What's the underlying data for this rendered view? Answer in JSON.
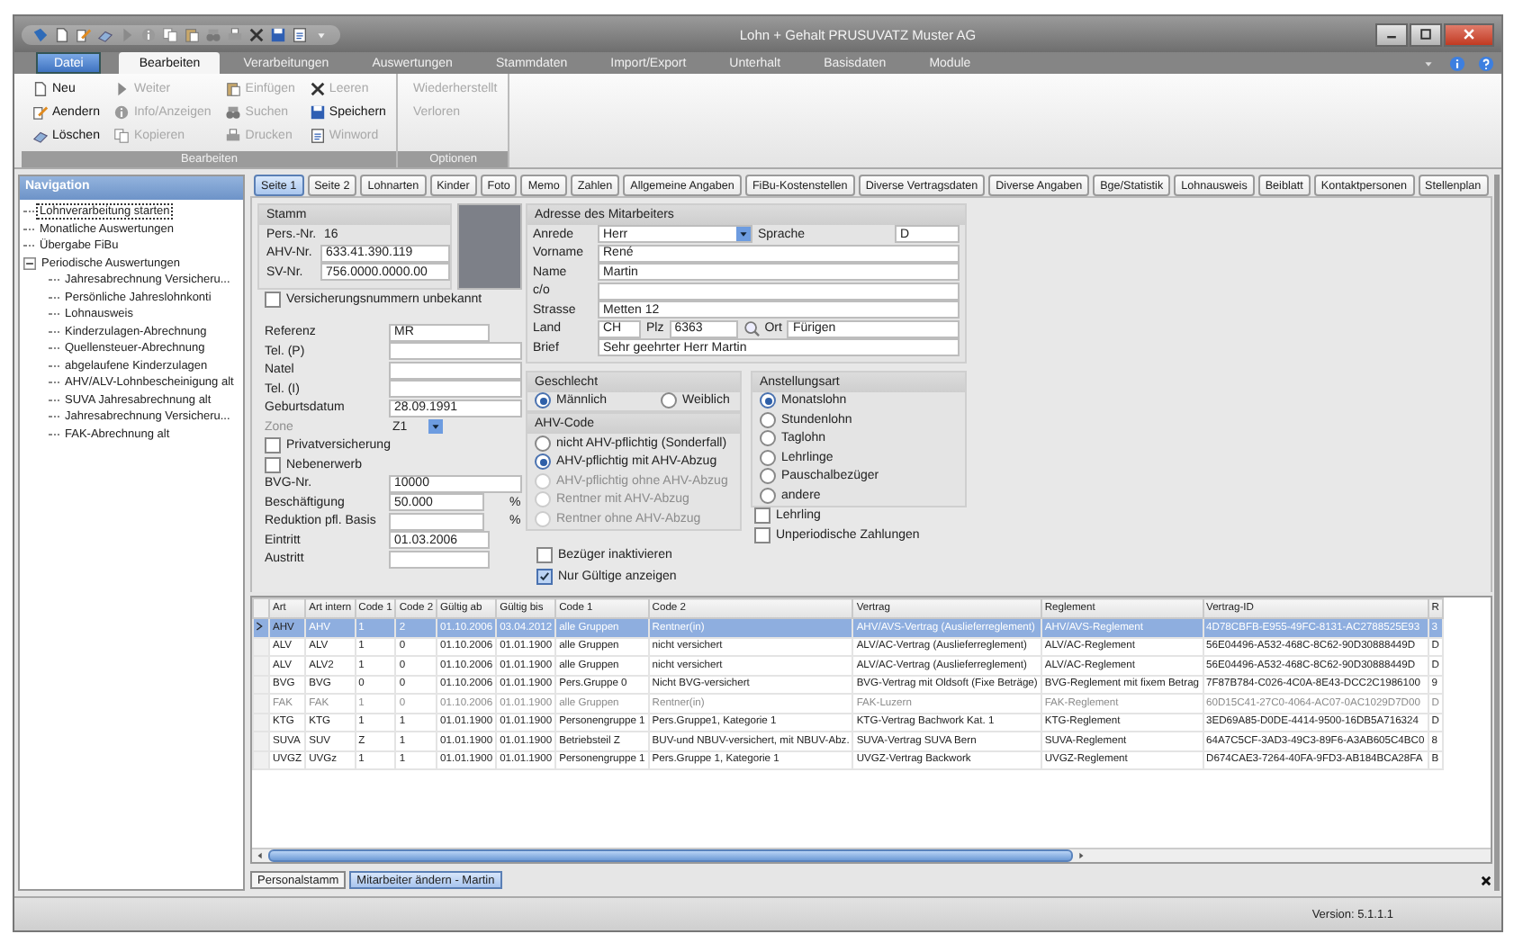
{
  "window": {
    "title": "Lohn + Gehalt PRUSUVATZ Muster AG"
  },
  "ribbon": {
    "file_button": "Datei",
    "tabs": [
      {
        "label": "Bearbeiten",
        "selected": true
      },
      {
        "label": "Verarbeitungen",
        "selected": false
      },
      {
        "label": "Auswertungen",
        "selected": false
      },
      {
        "label": "Stammdaten",
        "selected": false
      },
      {
        "label": "Import/Export",
        "selected": false
      },
      {
        "label": "Unterhalt",
        "selected": false
      },
      {
        "label": "Basisdaten",
        "selected": false
      },
      {
        "label": "Module",
        "selected": false
      }
    ],
    "groups": [
      {
        "label": "Bearbeiten",
        "items": [
          {
            "label": "Neu",
            "disabled": false
          },
          {
            "label": "Aendern",
            "disabled": false
          },
          {
            "label": "Löschen",
            "disabled": false
          },
          {
            "label": "Weiter",
            "disabled": true
          },
          {
            "label": "Info/Anzeigen",
            "disabled": true
          },
          {
            "label": "Kopieren",
            "disabled": true
          },
          {
            "label": "Einfügen",
            "disabled": true
          },
          {
            "label": "Suchen",
            "disabled": true
          },
          {
            "label": "Drucken",
            "disabled": true
          },
          {
            "label": "Leeren",
            "disabled": true
          },
          {
            "label": "Speichern",
            "disabled": false
          },
          {
            "label": "Winword",
            "disabled": true
          }
        ]
      },
      {
        "label": "Optionen",
        "items": [
          {
            "label": "Wiederherstellt",
            "disabled": true
          },
          {
            "label": "Verloren",
            "disabled": true
          }
        ]
      }
    ]
  },
  "navigation": {
    "title": "Navigation",
    "items": [
      {
        "label": "Lohnverarbeitung starten",
        "selected": true
      },
      {
        "label": "Monatliche Auswertungen",
        "selected": false
      },
      {
        "label": "Übergabe FiBu",
        "selected": false
      },
      {
        "label": "Periodische Auswertungen",
        "selected": false,
        "expanded": true,
        "children": [
          {
            "label": "Jahresabrechnung Versicheru...",
            "selected": false
          },
          {
            "label": "Persönliche Jahreslohnkonti",
            "selected": false
          },
          {
            "label": "Lohnausweis",
            "selected": false
          },
          {
            "label": "Kinderzulagen-Abrechnung",
            "selected": false
          },
          {
            "label": "Quellensteuer-Abrechnung",
            "selected": false
          },
          {
            "label": "abgelaufene Kinderzulagen",
            "selected": false
          },
          {
            "label": "AHV/ALV-Lohnbescheinigung alt",
            "selected": false
          },
          {
            "label": "SUVA Jahresabrechnung alt",
            "selected": false
          },
          {
            "label": "Jahresabrechnung Versicheru...",
            "selected": false
          },
          {
            "label": "FAK-Abrechnung alt",
            "selected": false
          }
        ]
      }
    ]
  },
  "tabs": [
    {
      "label": "Seite 1",
      "selected": true
    },
    {
      "label": "Seite 2",
      "selected": false
    },
    {
      "label": "Lohnarten",
      "selected": false
    },
    {
      "label": "Kinder",
      "selected": false
    },
    {
      "label": "Foto",
      "selected": false
    },
    {
      "label": "Memo",
      "selected": false
    },
    {
      "label": "Zahlen",
      "selected": false
    },
    {
      "label": "Allgemeine Angaben",
      "selected": false
    },
    {
      "label": "FiBu-Kostenstellen",
      "selected": false
    },
    {
      "label": "Diverse Vertragsdaten",
      "selected": false
    },
    {
      "label": "Diverse Angaben",
      "selected": false
    },
    {
      "label": "Bge/Statistik",
      "selected": false
    },
    {
      "label": "Lohnausweis",
      "selected": false
    },
    {
      "label": "Beiblatt",
      "selected": false
    },
    {
      "label": "Kontaktpersonen",
      "selected": false
    },
    {
      "label": "Stellenplan",
      "selected": false
    }
  ],
  "stamm": {
    "title": "Stamm",
    "fields": [
      {
        "kind": "readonly",
        "label": "Pers.-Nr.",
        "value": "16"
      },
      {
        "kind": "text",
        "label": "AHV-Nr.",
        "value": "633.41.390.119"
      },
      {
        "kind": "text",
        "label": "SV-Nr.",
        "value": "756.0000.0000.00"
      }
    ],
    "unknown_numbers": {
      "label": "Versicherungsnummern unbekannt",
      "checked": false
    }
  },
  "personal_fields": [
    {
      "kind": "short",
      "label": "Referenz",
      "value": "MR"
    },
    {
      "kind": "text",
      "label": "Tel. (P)"
    },
    {
      "kind": "text",
      "label": "Natel"
    },
    {
      "kind": "text",
      "label": "Tel. (I)"
    },
    {
      "kind": "text",
      "label": "Geburtsdatum",
      "value": "28.09.1991"
    },
    {
      "kind": "select",
      "label": "Zone",
      "value": "Z1",
      "disabled": true
    },
    {
      "kind": "checkbox",
      "label": "Privatversicherung",
      "checked": false
    },
    {
      "kind": "checkbox",
      "label": "Nebenerwerb",
      "checked": false
    },
    {
      "kind": "text",
      "label": "BVG-Nr.",
      "value": "10000"
    },
    {
      "kind": "unit",
      "label": "Beschäftigung",
      "value": "50.000",
      "unit": "%"
    },
    {
      "kind": "unit",
      "label": "Reduktion pfl. Basis",
      "unit": "%"
    },
    {
      "kind": "short",
      "label": "Eintritt",
      "value": "01.03.2006"
    },
    {
      "kind": "short",
      "label": "Austritt"
    }
  ],
  "address": {
    "title": "Adresse des Mitarbeiters",
    "fields": [
      {
        "kind": "select",
        "label": "Anrede",
        "value": "Herr",
        "same_line": false
      },
      {
        "kind": "short",
        "label": "Sprache",
        "value": "D",
        "same_line": true
      },
      {
        "kind": "text",
        "label": "Vorname",
        "value": "René",
        "same_line": false
      },
      {
        "kind": "text",
        "label": "Name",
        "value": "Martin",
        "same_line": false
      },
      {
        "kind": "text",
        "label": "c/o",
        "same_line": false
      },
      {
        "kind": "text",
        "label": "Strasse",
        "value": "Metten 12",
        "same_line": false
      },
      {
        "kind": "tiny",
        "label": "Land",
        "value": "CH",
        "same_line": false
      },
      {
        "kind": "lookup",
        "label": "Plz",
        "value": "6363",
        "same_line": true
      },
      {
        "kind": "text",
        "label": "Ort",
        "value": "Fürigen",
        "same_line": true
      },
      {
        "kind": "text",
        "label": "Brief",
        "value": "Sehr geehrter Herr Martin",
        "same_line": false
      }
    ]
  },
  "geschlecht": {
    "title": "Geschlecht",
    "options": [
      {
        "label": "Männlich",
        "selected": true,
        "disabled": false
      },
      {
        "label": "Weiblich",
        "selected": false,
        "disabled": false
      }
    ]
  },
  "ahv_code": {
    "title": "AHV-Code",
    "options": [
      {
        "label": "nicht AHV-pflichtig (Sonderfall)",
        "selected": false,
        "disabled": false
      },
      {
        "label": "AHV-pflichtig mit AHV-Abzug",
        "selected": true,
        "disabled": false
      },
      {
        "label": "AHV-pflichtig ohne AHV-Abzug",
        "selected": false,
        "disabled": true
      },
      {
        "label": "Rentner mit AHV-Abzug",
        "selected": false,
        "disabled": true
      },
      {
        "label": "Rentner ohne AHV-Abzug",
        "selected": false,
        "disabled": true
      }
    ]
  },
  "anstellungsart": {
    "title": "Anstellungsart",
    "options": [
      {
        "label": "Monatslohn",
        "selected": true,
        "disabled": false
      },
      {
        "label": "Stundenlohn",
        "selected": false,
        "disabled": false
      },
      {
        "label": "Taglohn",
        "selected": false,
        "disabled": false
      },
      {
        "label": "Lehrlinge",
        "selected": false,
        "disabled": false
      },
      {
        "label": "Pauschalbezüger",
        "selected": false,
        "disabled": false
      },
      {
        "label": "andere",
        "selected": false,
        "disabled": false
      }
    ]
  },
  "flags": [
    {
      "label": "Lehrling",
      "checked": false
    },
    {
      "label": "Unperiodische Zahlungen",
      "checked": false
    }
  ],
  "options": [
    {
      "label": "Bezüger inaktivieren",
      "checked": false
    },
    {
      "label": "Nur Gültige anzeigen",
      "checked": true
    }
  ],
  "table": {
    "columns": [
      "Art",
      "Art intern",
      "Code 1",
      "Code 2",
      "Gültig ab",
      "Gültig bis",
      "Code 1",
      "Code 2",
      "Vertrag",
      "Reglement",
      "Vertrag-ID",
      "R"
    ],
    "rows": [
      {
        "selected": true,
        "inactive": false,
        "cells": [
          "AHV",
          "AHV",
          "1",
          "2",
          "01.10.2006",
          "03.04.2012",
          "alle Gruppen",
          "Rentner(in)",
          "AHV/AVS-Vertrag (Auslieferreglement)",
          "AHV/AVS-Reglement",
          "4D78CBFB-E955-49FC-8131-AC2788525E93",
          "3"
        ]
      },
      {
        "selected": false,
        "inactive": false,
        "cells": [
          "ALV",
          "ALV",
          "1",
          "0",
          "01.10.2006",
          "01.01.1900",
          "alle Gruppen",
          "nicht versichert",
          "ALV/AC-Vertrag (Auslieferreglement)",
          "ALV/AC-Reglement",
          "56E04496-A532-468C-8C62-90D30888449D",
          "D"
        ]
      },
      {
        "selected": false,
        "inactive": false,
        "cells": [
          "ALV",
          "ALV2",
          "1",
          "0",
          "01.10.2006",
          "01.01.1900",
          "alle Gruppen",
          "nicht versichert",
          "ALV/AC-Vertrag (Auslieferreglement)",
          "ALV/AC-Reglement",
          "56E04496-A532-468C-8C62-90D30888449D",
          "D"
        ]
      },
      {
        "selected": false,
        "inactive": false,
        "cells": [
          "BVG",
          "BVG",
          "0",
          "0",
          "01.10.2006",
          "01.01.1900",
          "Pers.Gruppe 0",
          "Nicht BVG-versichert",
          "BVG-Vertrag mit Oldsoft (Fixe Beträge)",
          "BVG-Reglement mit fixem Betrag",
          "7F87B784-C026-4C0A-8E43-DCC2C1986100",
          "9"
        ]
      },
      {
        "selected": false,
        "inactive": true,
        "cells": [
          "FAK",
          "FAK",
          "1",
          "0",
          "01.10.2006",
          "01.01.1900",
          "alle Gruppen",
          "Rentner(in)",
          "FAK-Luzern",
          "FAK-Reglement",
          "60D15C41-27C0-4064-AC07-0AC1029D7D00",
          "D"
        ]
      },
      {
        "selected": false,
        "inactive": false,
        "cells": [
          "KTG",
          "KTG",
          "1",
          "1",
          "01.01.1900",
          "01.01.1900",
          "Personengruppe 1",
          "Pers.Gruppe1, Kategorie 1",
          "KTG-Vertrag Bachwork Kat. 1",
          "KTG-Reglement",
          "3ED69A85-D0DE-4414-9500-16DB5A716324",
          "D"
        ]
      },
      {
        "selected": false,
        "inactive": false,
        "cells": [
          "SUVA",
          "SUV",
          "Z",
          "1",
          "01.01.1900",
          "01.01.1900",
          "Betriebsteil Z",
          "BUV-und NBUV-versichert, mit NBUV-Abz.",
          "SUVA-Vertrag SUVA Bern",
          "SUVA-Reglement",
          "64A7C5CF-3AD3-49C3-89F6-A3AB605C4BC0",
          "8"
        ]
      },
      {
        "selected": false,
        "inactive": false,
        "cells": [
          "UVGZ",
          "UVGz",
          "1",
          "1",
          "01.01.1900",
          "01.01.1900",
          "Personengruppe 1",
          "Pers.Gruppe 1, Kategorie 1",
          "UVGZ-Vertrag Backwork",
          "UVGZ-Reglement",
          "D674CAE3-7264-40FA-9FD3-AB184BCA28FA",
          "B"
        ]
      }
    ]
  },
  "document_tabs": [
    {
      "label": "Personalstamm",
      "selected": false
    },
    {
      "label": "Mitarbeiter ändern - Martin",
      "selected": true
    }
  ],
  "status_bar": {
    "version": "Version: 5.1.1.1"
  }
}
